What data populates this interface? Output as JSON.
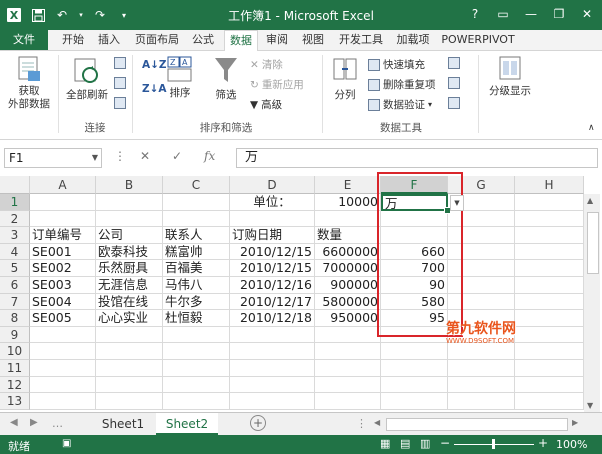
{
  "window": {
    "title": "工作簿1 - Microsoft Excel",
    "controls": [
      "?",
      "▭",
      "—",
      "❐",
      "✕"
    ]
  },
  "qat_icons": [
    "save-icon",
    "undo-icon",
    "redo-icon"
  ],
  "tabs": [
    {
      "label": "文件"
    },
    {
      "label": "开始"
    },
    {
      "label": "插入"
    },
    {
      "label": "页面布局"
    },
    {
      "label": "公式"
    },
    {
      "label": "数据"
    },
    {
      "label": "审阅"
    },
    {
      "label": "视图"
    },
    {
      "label": "开发工具"
    },
    {
      "label": "加载项"
    },
    {
      "label": "POWERPIVOT"
    }
  ],
  "active_tab": "数据",
  "ribbon": {
    "get_external": "获取\n外部数据",
    "refresh_all": "全部刷新",
    "group_connections": "连接",
    "sort": "排序",
    "filter": "筛选",
    "clear": "清除",
    "reapply": "重新应用",
    "advanced": "高级",
    "group_sort_filter": "排序和筛选",
    "split": "分列",
    "flash_fill": "快速填充",
    "remove_dup": "删除重复项",
    "validation": "数据验证",
    "group_data_tools": "数据工具",
    "outline": "分级显示"
  },
  "formula_bar": {
    "name_box": "F1",
    "content": "万"
  },
  "columns": [
    "A",
    "B",
    "C",
    "D",
    "E",
    "F",
    "G",
    "H"
  ],
  "rows": [
    "1",
    "2",
    "3",
    "4",
    "5",
    "6",
    "7",
    "8",
    "9",
    "10",
    "11",
    "12",
    "13"
  ],
  "cells": {
    "d1": "单位：",
    "e1": "10000",
    "f1": "万",
    "a3": "订单编号",
    "b3": "公司",
    "c3": "联系人",
    "d3": "订购日期",
    "e3": "数量",
    "data_rows": [
      {
        "id": "SE001",
        "company": "欧泰科技",
        "contact": "糕富帅",
        "date": "2010/12/15",
        "qty": "6600000",
        "f": "660"
      },
      {
        "id": "SE002",
        "company": "乐然厨具",
        "contact": "百福美",
        "date": "2010/12/15",
        "qty": "7000000",
        "f": "700"
      },
      {
        "id": "SE003",
        "company": "无涯信息",
        "contact": "马伟八",
        "date": "2010/12/16",
        "qty": "900000",
        "f": "90"
      },
      {
        "id": "SE004",
        "company": "投馆在线",
        "contact": "牛尔多",
        "date": "2010/12/17",
        "qty": "5800000",
        "f": "580"
      },
      {
        "id": "SE005",
        "company": "心心实业",
        "contact": "杜恒毅",
        "date": "2010/12/18",
        "qty": "950000",
        "f": "95"
      }
    ]
  },
  "sheets": [
    {
      "label": "Sheet1"
    },
    {
      "label": "Sheet2"
    }
  ],
  "active_sheet": "Sheet2",
  "status": {
    "ready": "就绪",
    "zoom": "100%"
  },
  "watermark": {
    "text": "第九软件网",
    "url": "WWW.D9SOFT.COM"
  },
  "colors": {
    "excel_green": "#217346",
    "highlight_red": "#d9252a"
  }
}
